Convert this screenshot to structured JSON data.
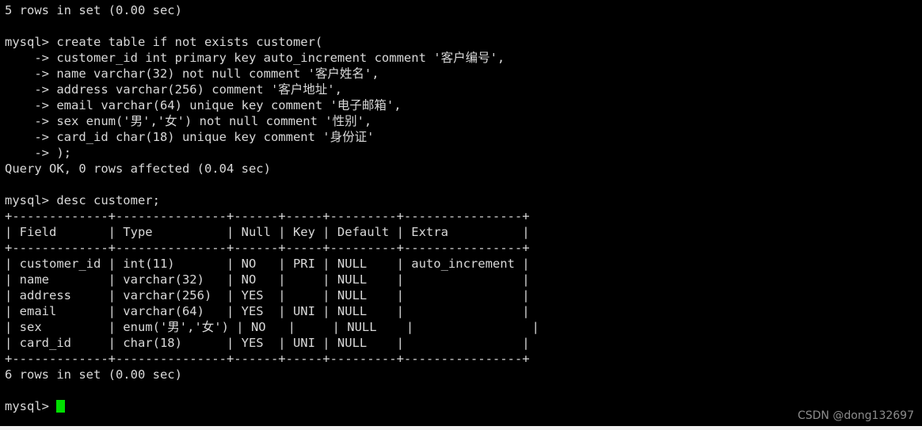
{
  "terminal": {
    "background_color": "#000000",
    "text_color": "#d8d8d8",
    "cursor_color": "#00e000",
    "prompt": "mysql>",
    "continuation_prompt": "    ->",
    "lines": [
      "5 rows in set (0.00 sec)",
      "",
      "mysql> create table if not exists customer(",
      "    -> customer_id int primary key auto_increment comment '客户编号',",
      "    -> name varchar(32) not null comment '客户姓名',",
      "    -> address varchar(256) comment '客户地址',",
      "    -> email varchar(64) unique key comment '电子邮箱',",
      "    -> sex enum('男','女') not null comment '性别',",
      "    -> card_id char(18) unique key comment '身份证'",
      "    -> );",
      "Query OK, 0 rows affected (0.04 sec)",
      "",
      "mysql> desc customer;",
      "+-------------+---------------+------+-----+---------+----------------+",
      "| Field       | Type          | Null | Key | Default | Extra          |",
      "+-------------+---------------+------+-----+---------+----------------+",
      "| customer_id | int(11)       | NO   | PRI | NULL    | auto_increment |",
      "| name        | varchar(32)   | NO   |     | NULL    |                |",
      "| address     | varchar(256)  | YES  |     | NULL    |                |",
      "| email       | varchar(64)   | YES  | UNI | NULL    |                |",
      "| sex         | enum('男','女') | NO   |     | NULL    |                |",
      "| card_id     | char(18)      | YES  | UNI | NULL    |                |",
      "+-------------+---------------+------+-----+---------+----------------+",
      "6 rows in set (0.00 sec)",
      ""
    ],
    "final_prompt": "mysql> "
  },
  "sql": {
    "create_statement": {
      "header": "create table if not exists customer(",
      "columns": [
        {
          "name": "customer_id",
          "type": "int",
          "constraints": "primary key auto_increment",
          "comment": "客户编号"
        },
        {
          "name": "name",
          "type": "varchar(32)",
          "constraints": "not null",
          "comment": "客户姓名"
        },
        {
          "name": "address",
          "type": "varchar(256)",
          "constraints": "",
          "comment": "客户地址"
        },
        {
          "name": "email",
          "type": "varchar(64)",
          "constraints": "unique key",
          "comment": "电子邮箱"
        },
        {
          "name": "sex",
          "type": "enum('男','女')",
          "constraints": "not null",
          "comment": "性别"
        },
        {
          "name": "card_id",
          "type": "char(18)",
          "constraints": "unique key",
          "comment": "身份证"
        }
      ],
      "result": "Query OK, 0 rows affected (0.04 sec)"
    },
    "desc_statement": {
      "command": "desc customer;",
      "columns": [
        "Field",
        "Type",
        "Null",
        "Key",
        "Default",
        "Extra"
      ],
      "rows": [
        [
          "customer_id",
          "int(11)",
          "NO",
          "PRI",
          "NULL",
          "auto_increment"
        ],
        [
          "name",
          "varchar(32)",
          "NO",
          "",
          "NULL",
          ""
        ],
        [
          "address",
          "varchar(256)",
          "YES",
          "",
          "NULL",
          ""
        ],
        [
          "email",
          "varchar(64)",
          "YES",
          "UNI",
          "NULL",
          ""
        ],
        [
          "sex",
          "enum('男','女')",
          "NO",
          "",
          "NULL",
          ""
        ],
        [
          "card_id",
          "char(18)",
          "YES",
          "UNI",
          "NULL",
          ""
        ]
      ],
      "result": "6 rows in set (0.00 sec)"
    },
    "previous_result": "5 rows in set (0.00 sec)"
  },
  "watermark": {
    "text": "CSDN @dong132697",
    "color": "#8c8c8c"
  }
}
